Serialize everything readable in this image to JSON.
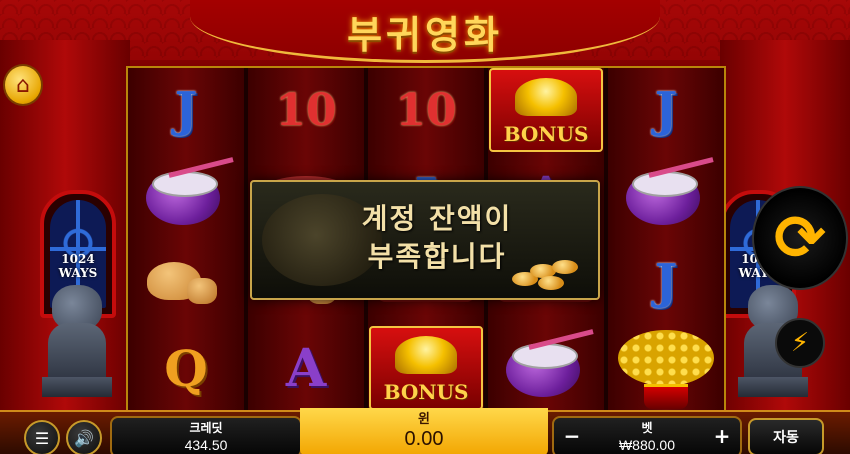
{
  "game": {
    "title": "부귀영화"
  },
  "side": {
    "ways_label": "1024\nWAYS"
  },
  "reels": [
    [
      "J",
      "drum",
      "cookie",
      "Q"
    ],
    [
      "10",
      "fan",
      "cookie",
      "A"
    ],
    [
      "10",
      "J",
      "fan",
      "BONUS"
    ],
    [
      "BONUS",
      "A",
      "fan",
      "drum"
    ],
    [
      "J",
      "drum",
      "J",
      "tree"
    ]
  ],
  "symbols": {
    "bonus_label": "BONUS"
  },
  "dialog": {
    "message": "계정 잔액이\n부족합니다"
  },
  "bottom_bar": {
    "credit_label": "크레딧",
    "credit_value": "434.50",
    "win_label": "윈",
    "win_value": "0.00",
    "bet_label": "벳",
    "bet_value": "₩880.00",
    "bet_minus": "−",
    "bet_plus": "+",
    "auto_label": "자동"
  },
  "icons": {
    "home": "home-icon",
    "spin": "refresh-icon",
    "turbo": "lightning-icon",
    "menu": "menu-icon",
    "sound": "speaker-icon"
  },
  "colors": {
    "accent": "#ffb400",
    "frame": "#c40c0c",
    "win_bar": "#f2a500"
  }
}
